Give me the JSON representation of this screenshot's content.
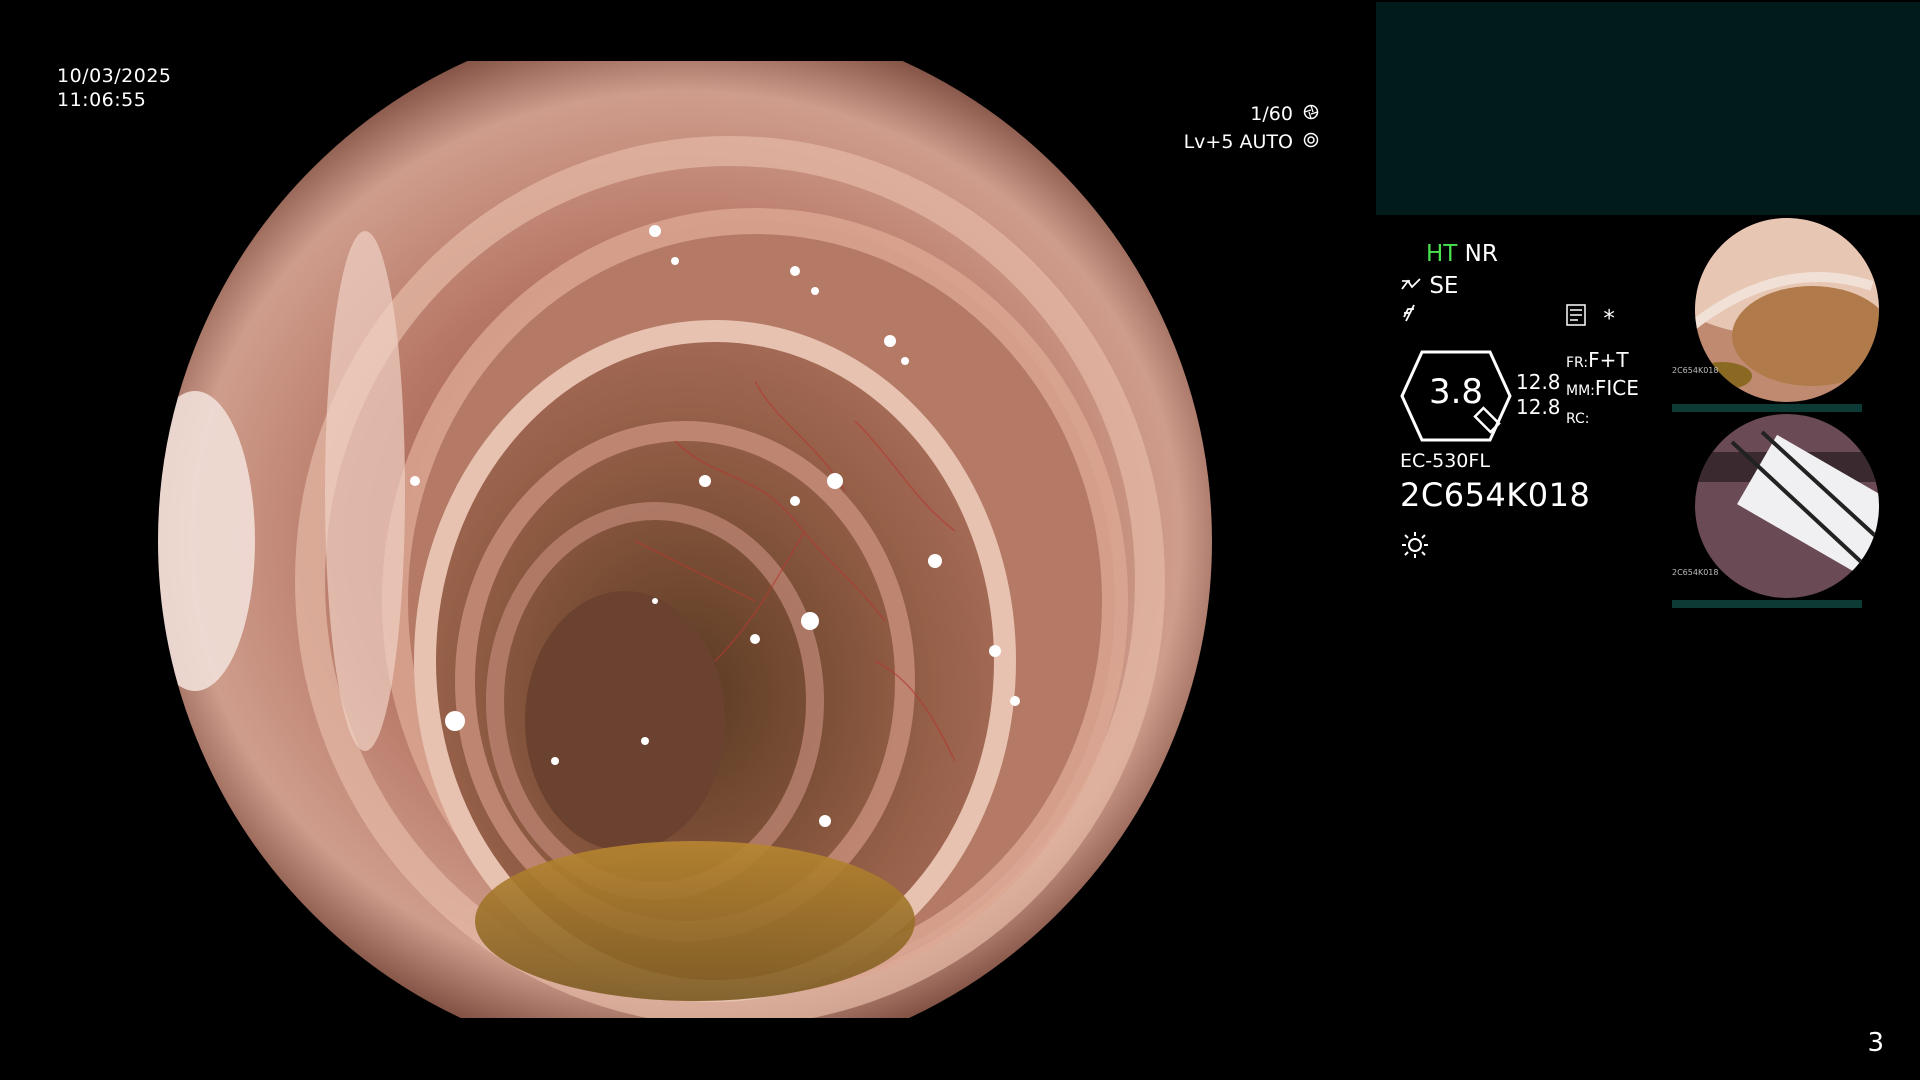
{
  "header": {
    "date": "10/03/2025",
    "time": "11:06:55"
  },
  "exposure": {
    "shutter": "1/60",
    "shutter_icon": "shutter-icon",
    "level": "Lv+5",
    "mode": "AUTO",
    "auto_icon": "iris-icon"
  },
  "status": {
    "ht": "HT",
    "nr": "NR",
    "se": "SE",
    "se_icon": "enhancement-icon",
    "filter_icon": "filter-icon",
    "record_icon": "record-icon",
    "asterisk": "*",
    "zoom_value": "3.8",
    "value_1": "12.8",
    "value_2": "12.8",
    "fr_label": "FR:",
    "fr_value": "F+T",
    "mm_label": "MM:",
    "mm_value": "FICE",
    "rc_label": "RC:",
    "rc_value": "",
    "scope_model": "EC-530FL",
    "serial": "2C654K018",
    "light_icon": "brightness-icon"
  },
  "thumbnails": [
    {
      "label_left": "2C654K018",
      "name": "thumbnail-colon-fold"
    },
    {
      "label_left": "2C654K018",
      "name": "thumbnail-specimen-label"
    }
  ],
  "page_number": "3",
  "colors": {
    "background": "#000000",
    "teal_panel": "#011a1a",
    "ht_green": "#49e04d",
    "tissue": "#c98f78"
  }
}
